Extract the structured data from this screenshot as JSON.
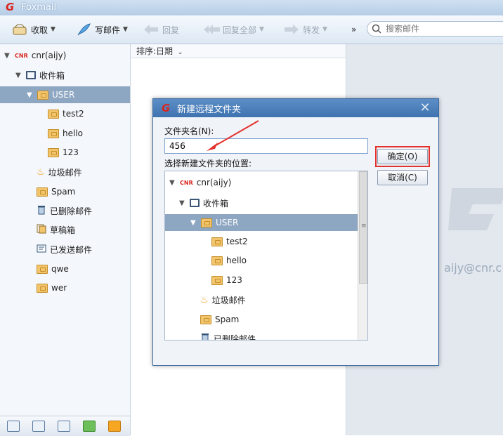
{
  "app": {
    "title": "Foxmail"
  },
  "toolbar": {
    "receive": "收取",
    "compose": "写邮件",
    "reply": "回复",
    "reply_all": "回复全部",
    "forward": "转发",
    "more": "»",
    "search_placeholder": "搜索邮件"
  },
  "tree": {
    "account": "cnr(aijy)",
    "account_tag": "CNR",
    "inbox": "收件箱",
    "user": "USER",
    "subfolders": [
      "test2",
      "hello",
      "123"
    ],
    "junk": "垃圾邮件",
    "spam": "Spam",
    "deleted": "已删除邮件",
    "drafts": "草稿箱",
    "sent": "已发送邮件",
    "qwe": "qwe",
    "wer": "wer"
  },
  "mail_list": {
    "sort_label": "排序:日期"
  },
  "right": {
    "account_email": "aijy@cnr.c"
  },
  "dialog": {
    "title": "新建远程文件夹",
    "name_label": "文件夹名(N):",
    "name_value": "456",
    "location_label": "选择新建文件夹的位置:",
    "ok": "确定(O)",
    "cancel": "取消(C)",
    "tree": {
      "account": "cnr(aijy)",
      "account_tag": "CNR",
      "inbox": "收件箱",
      "user": "USER",
      "subfolders": [
        "test2",
        "hello",
        "123"
      ],
      "junk": "垃圾邮件",
      "spam": "Spam",
      "deleted": "已删除邮件"
    }
  },
  "colors": {
    "selection": "#8da6c2",
    "highlight_box": "#e3312c",
    "dialog_title": "#3f73b0"
  }
}
